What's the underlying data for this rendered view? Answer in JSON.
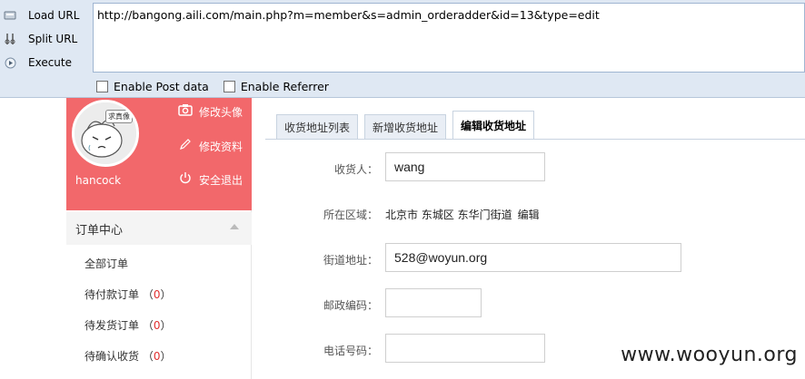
{
  "hackbar": {
    "load_label": "Load URL",
    "split_label": "Split URL",
    "execute_label": "Execute",
    "url_value": "http://bangong.aili.com/main.php?m=member&s=admin_orderadder&id=13&type=edit",
    "post_label": "Enable Post data",
    "referrer_label": "Enable Referrer"
  },
  "sidebar": {
    "avatar_bubble": "求真像",
    "username": "hancock",
    "links": {
      "avatar": "修改头像",
      "profile": "修改资料",
      "logout": "安全退出"
    },
    "menu_title": "订单中心",
    "items": [
      {
        "label": "全部订单",
        "count": ""
      },
      {
        "label": "待付款订单",
        "count": "0"
      },
      {
        "label": "待发货订单",
        "count": "0"
      },
      {
        "label": "待确认收货",
        "count": "0"
      }
    ]
  },
  "tabs": [
    {
      "label": "收货地址列表",
      "active": false
    },
    {
      "label": "新增收货地址",
      "active": false
    },
    {
      "label": "编辑收货地址",
      "active": true
    }
  ],
  "form": {
    "name_label": "收货人：",
    "name_value": "wang",
    "region_label": "所在区域：",
    "region_value": "北京市 东城区 东华门街道",
    "region_edit": "编辑",
    "street_label": "街道地址：",
    "street_value": "528@woyun.org",
    "zip_label": "邮政编码：",
    "zip_value": "",
    "phone_label": "电话号码：",
    "phone_value": ""
  },
  "watermark": "www.wooyun.org",
  "colors": {
    "profile_bg": "#f2686b",
    "hackbar_bg": "#dfe8f3",
    "count_red": "#e03030"
  }
}
